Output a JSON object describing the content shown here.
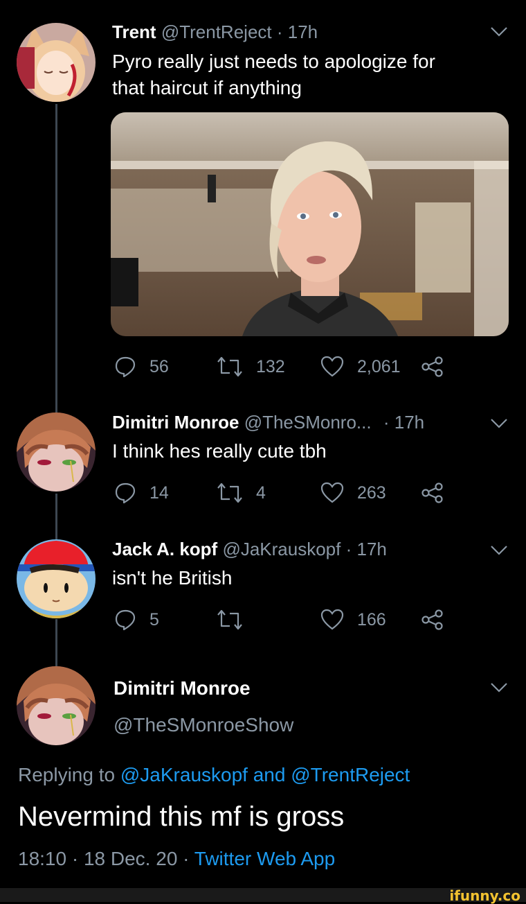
{
  "tweets": [
    {
      "name": "Trent",
      "handle": "@TrentReject",
      "sep": "·",
      "time": "17h",
      "text_line1": "Pyro really just needs to apologize for",
      "text_line2": "that haircut if anything",
      "replies": "56",
      "retweets": "132",
      "likes": "2,061"
    },
    {
      "name": "Dimitri Monroe",
      "handle": "@TheSMonro...",
      "sep": "·",
      "time": "17h",
      "text": "I think hes really cute tbh",
      "replies": "14",
      "retweets": "4",
      "likes": "263"
    },
    {
      "name": "Jack A. kopf",
      "handle": "@JaKrauskopf",
      "sep": "·",
      "time": "17h",
      "text": "isn't he British",
      "replies": "5",
      "retweets": "",
      "likes": "166"
    }
  ],
  "main_tweet": {
    "name": "Dimitri Monroe",
    "handle": "@TheSMonroeShow",
    "replying_prefix": "Replying to",
    "replying_user1": "@JaKrauskopf",
    "replying_and": "and",
    "replying_user2": "@TrentReject",
    "text": "Nevermind this mf is gross",
    "time": "18:10",
    "dot1": "·",
    "date": "18 Dec. 20",
    "dot2": "·",
    "source": "Twitter Web App"
  },
  "watermark": "ifunny.co",
  "colors": {
    "background": "#000000",
    "secondary_text": "#8b98a5",
    "link": "#1d9bf0",
    "thread_line": "#3d4752"
  },
  "icons": [
    "reply-icon",
    "retweet-icon",
    "like-icon",
    "share-icon",
    "chevron-down-icon"
  ]
}
